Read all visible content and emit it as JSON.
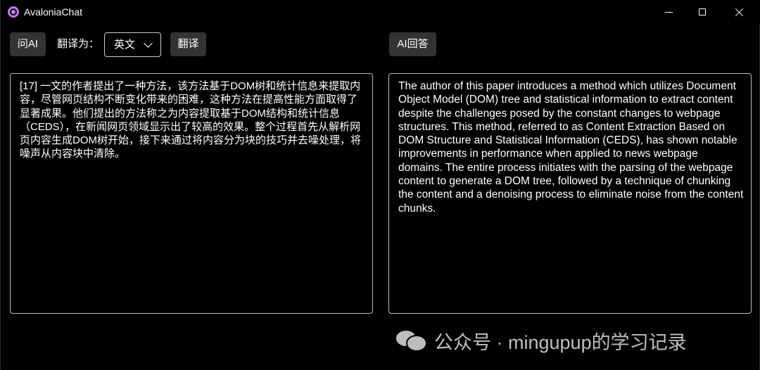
{
  "window": {
    "title": "AvaloniaChat"
  },
  "toolbar": {
    "ask_ai_label": "问AI",
    "translate_to_label": "翻译为：",
    "language_selected": "英文",
    "translate_label": "翻译",
    "ai_answer_label": "AI回答"
  },
  "source_text": "[17] 一文的作者提出了一种方法，该方法基于DOM树和统计信息来提取内容，尽管网页结构不断变化带来的困难，这种方法在提高性能方面取得了显著成果。他们提出的方法称之为内容提取基于DOM结构和统计信息（CEDS），在新闻网页领域显示出了较高的效果。整个过程首先从解析网页内容生成DOM树开始，接下来通过将内容分为块的技巧并去噪处理，将噪声从内容块中清除。",
  "translated_text": "The author of this paper introduces a method which utilizes Document Object Model (DOM) tree and statistical information to extract content despite the challenges posed by the constant changes to webpage structures. This method, referred to as Content Extraction Based on DOM Structure and Statistical Information (CEDS), has shown notable improvements in performance when applied to news webpage domains. The entire process initiates with the parsing of the webpage content to generate a DOM tree, followed by a technique of chunking the content and a denoising process to eliminate noise from the content chunks.",
  "watermark": {
    "icon": "wechat-icon",
    "text": "公众号 · mingupup的学习记录"
  },
  "colors": {
    "background": "#000000",
    "button": "#333333",
    "border": "#bdbdbd",
    "app_icon": "#c07bf0"
  }
}
